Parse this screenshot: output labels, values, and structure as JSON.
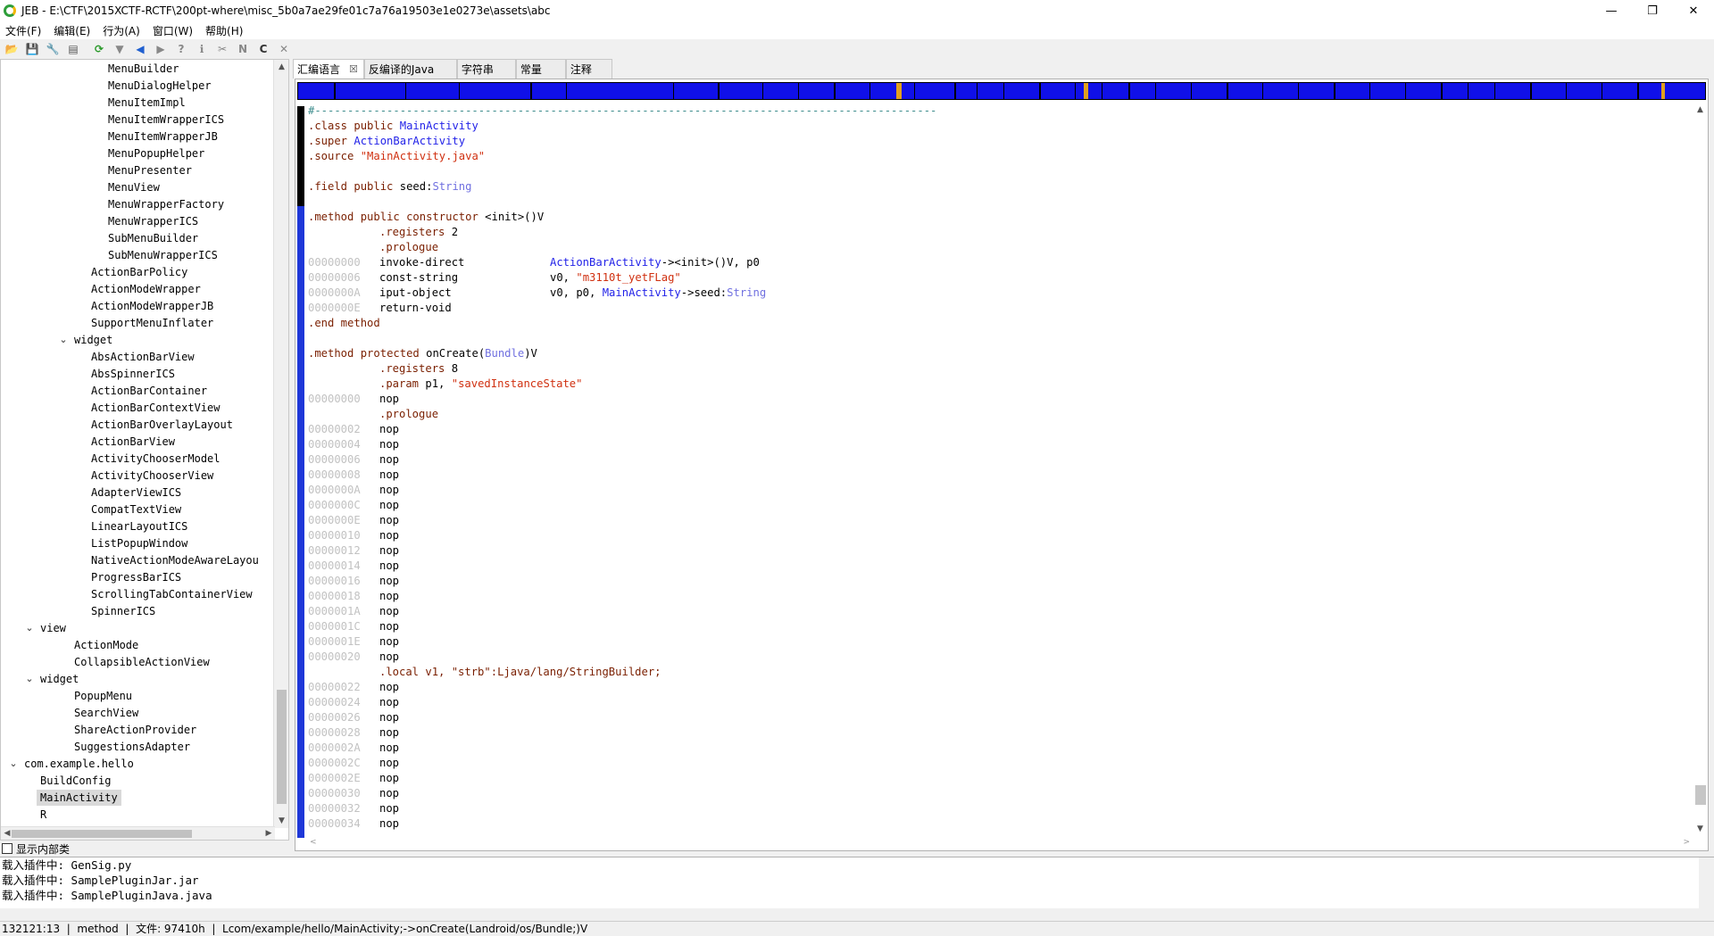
{
  "window": {
    "title": "JEB - E:\\CTF\\2015XCTF-RCTF\\200pt-where\\misc_5b0a7ae29fe01c7a76a19503e1e0273e\\assets\\abc",
    "minimize": "—",
    "maximize": "❐",
    "close": "✕"
  },
  "menu": {
    "file": "文件(F)",
    "edit": "编辑(E)",
    "action": "行为(A)",
    "window": "窗口(W)",
    "help": "帮助(H)"
  },
  "toolbar": {
    "open": "📂",
    "save": "💾",
    "props": "🔧",
    "export": "▤",
    "refresh": "⟳",
    "filter": "▼",
    "back": "◀",
    "forward": "▶",
    "help1": "?",
    "info": "ℹ",
    "xref": "✂",
    "rename": "N",
    "comment": "C",
    "delete": "✕"
  },
  "tree": {
    "nodes": [
      {
        "label": "MenuBuilder",
        "indent": 0
      },
      {
        "label": "MenuDialogHelper",
        "indent": 0
      },
      {
        "label": "MenuItemImpl",
        "indent": 0
      },
      {
        "label": "MenuItemWrapperICS",
        "indent": 0
      },
      {
        "label": "MenuItemWrapperJB",
        "indent": 0
      },
      {
        "label": "MenuPopupHelper",
        "indent": 0
      },
      {
        "label": "MenuPresenter",
        "indent": 0
      },
      {
        "label": "MenuView",
        "indent": 0
      },
      {
        "label": "MenuWrapperFactory",
        "indent": 0
      },
      {
        "label": "MenuWrapperICS",
        "indent": 0
      },
      {
        "label": "SubMenuBuilder",
        "indent": 0
      },
      {
        "label": "SubMenuWrapperICS",
        "indent": 0
      },
      {
        "label": "ActionBarPolicy",
        "indent": 1
      },
      {
        "label": "ActionModeWrapper",
        "indent": 1
      },
      {
        "label": "ActionModeWrapperJB",
        "indent": 1
      },
      {
        "label": "SupportMenuInflater",
        "indent": 1
      },
      {
        "label": "widget",
        "indent": 2,
        "expanded": true
      },
      {
        "label": "AbsActionBarView",
        "indent": 1
      },
      {
        "label": "AbsSpinnerICS",
        "indent": 1
      },
      {
        "label": "ActionBarContainer",
        "indent": 1
      },
      {
        "label": "ActionBarContextView",
        "indent": 1
      },
      {
        "label": "ActionBarOverlayLayout",
        "indent": 1
      },
      {
        "label": "ActionBarView",
        "indent": 1
      },
      {
        "label": "ActivityChooserModel",
        "indent": 1
      },
      {
        "label": "ActivityChooserView",
        "indent": 1
      },
      {
        "label": "AdapterViewICS",
        "indent": 1
      },
      {
        "label": "CompatTextView",
        "indent": 1
      },
      {
        "label": "LinearLayoutICS",
        "indent": 1
      },
      {
        "label": "ListPopupWindow",
        "indent": 1
      },
      {
        "label": "NativeActionModeAwareLayou",
        "indent": 1
      },
      {
        "label": "ProgressBarICS",
        "indent": 1
      },
      {
        "label": "ScrollingTabContainerView",
        "indent": 1
      },
      {
        "label": "SpinnerICS",
        "indent": 1
      },
      {
        "label": "view",
        "indent": 3,
        "expanded": true
      },
      {
        "label": "ActionMode",
        "indent": 2
      },
      {
        "label": "CollapsibleActionView",
        "indent": 2
      },
      {
        "label": "widget",
        "indent": 3,
        "expanded": true
      },
      {
        "label": "PopupMenu",
        "indent": 2
      },
      {
        "label": "SearchView",
        "indent": 2
      },
      {
        "label": "ShareActionProvider",
        "indent": 2
      },
      {
        "label": "SuggestionsAdapter",
        "indent": 2
      },
      {
        "label": "com.example.hello",
        "indent": 4,
        "expanded": true
      },
      {
        "label": "BuildConfig",
        "indent": 3
      },
      {
        "label": "MainActivity",
        "indent": 3,
        "selected": true
      },
      {
        "label": "R",
        "indent": 3
      }
    ]
  },
  "show_inner": "显示内部类",
  "tabs": [
    {
      "label": "汇编语言",
      "active": true,
      "close": "☒"
    },
    {
      "label": "反编译的Java"
    },
    {
      "label": "字符串"
    },
    {
      "label": "常量"
    },
    {
      "label": "注释"
    }
  ],
  "code": {
    "separator": "#-----------------------------------------------------------------------------------------------",
    "class_dir": ".class",
    "class_mod": "public",
    "class_name": "MainActivity",
    "super_dir": ".super",
    "super_name": "ActionBarActivity",
    "source_dir": ".source",
    "source_name": "\"MainActivity.java\"",
    "field_dir": ".field",
    "field_mod": "public",
    "field_name": "seed:",
    "field_type": "String",
    "m1_dir": ".method",
    "m1_mod": "public constructor",
    "m1_sig": "<init>()V",
    "m1_regs": ".registers",
    "m1_regs_n": "2",
    "m1_prologue": ".prologue",
    "i1_addr": "00000000",
    "i1_op": "invoke-direct",
    "i1_arg_cls": "ActionBarActivity",
    "i1_arg_rest": "-><init>()V, p0",
    "i2_addr": "00000006",
    "i2_op": "const-string",
    "i2_arg_reg": "v0,",
    "i2_arg_str": "\"m3110t_yetFLag\"",
    "i3_addr": "0000000A",
    "i3_op": "iput-object",
    "i3_arg_regs": "v0, p0,",
    "i3_arg_cls": "MainActivity",
    "i3_arg_field": "->seed:",
    "i3_arg_type": "String",
    "i4_addr": "0000000E",
    "i4_op": "return-void",
    "end_method": ".end method",
    "m2_dir": ".method",
    "m2_mod": "protected",
    "m2_name": "onCreate",
    "m2_paren_open": "(",
    "m2_param_type": "Bundle",
    "m2_paren_close": ")V",
    "m2_regs": ".registers",
    "m2_regs_n": "8",
    "m2_param": ".param",
    "m2_param_reg": "p1,",
    "m2_param_str": "\"savedInstanceState\"",
    "nop_first_addr": "00000000",
    "nop": "nop",
    "m2_prologue": ".prologue",
    "nops_a": [
      "00000002",
      "00000004",
      "00000006",
      "00000008",
      "0000000A",
      "0000000C",
      "0000000E",
      "00000010",
      "00000012",
      "00000014",
      "00000016",
      "00000018",
      "0000001A",
      "0000001C",
      "0000001E",
      "00000020"
    ],
    "local_line": ".local v1, \"strb\":Ljava/lang/StringBuilder;",
    "nops_b": [
      "00000022",
      "00000024",
      "00000026",
      "00000028",
      "0000002A",
      "0000002C",
      "0000002E",
      "00000030",
      "00000032",
      "00000034"
    ]
  },
  "console": {
    "lines": [
      "载入插件中: GenSig.py",
      "载入插件中: SamplePluginJar.jar",
      "载入插件中: SamplePluginJava.java"
    ]
  },
  "status": "132121:13  |  method  |  文件: 97410h  |  Lcom/example/hello/MainActivity;->onCreate(Landroid/os/Bundle;)V"
}
